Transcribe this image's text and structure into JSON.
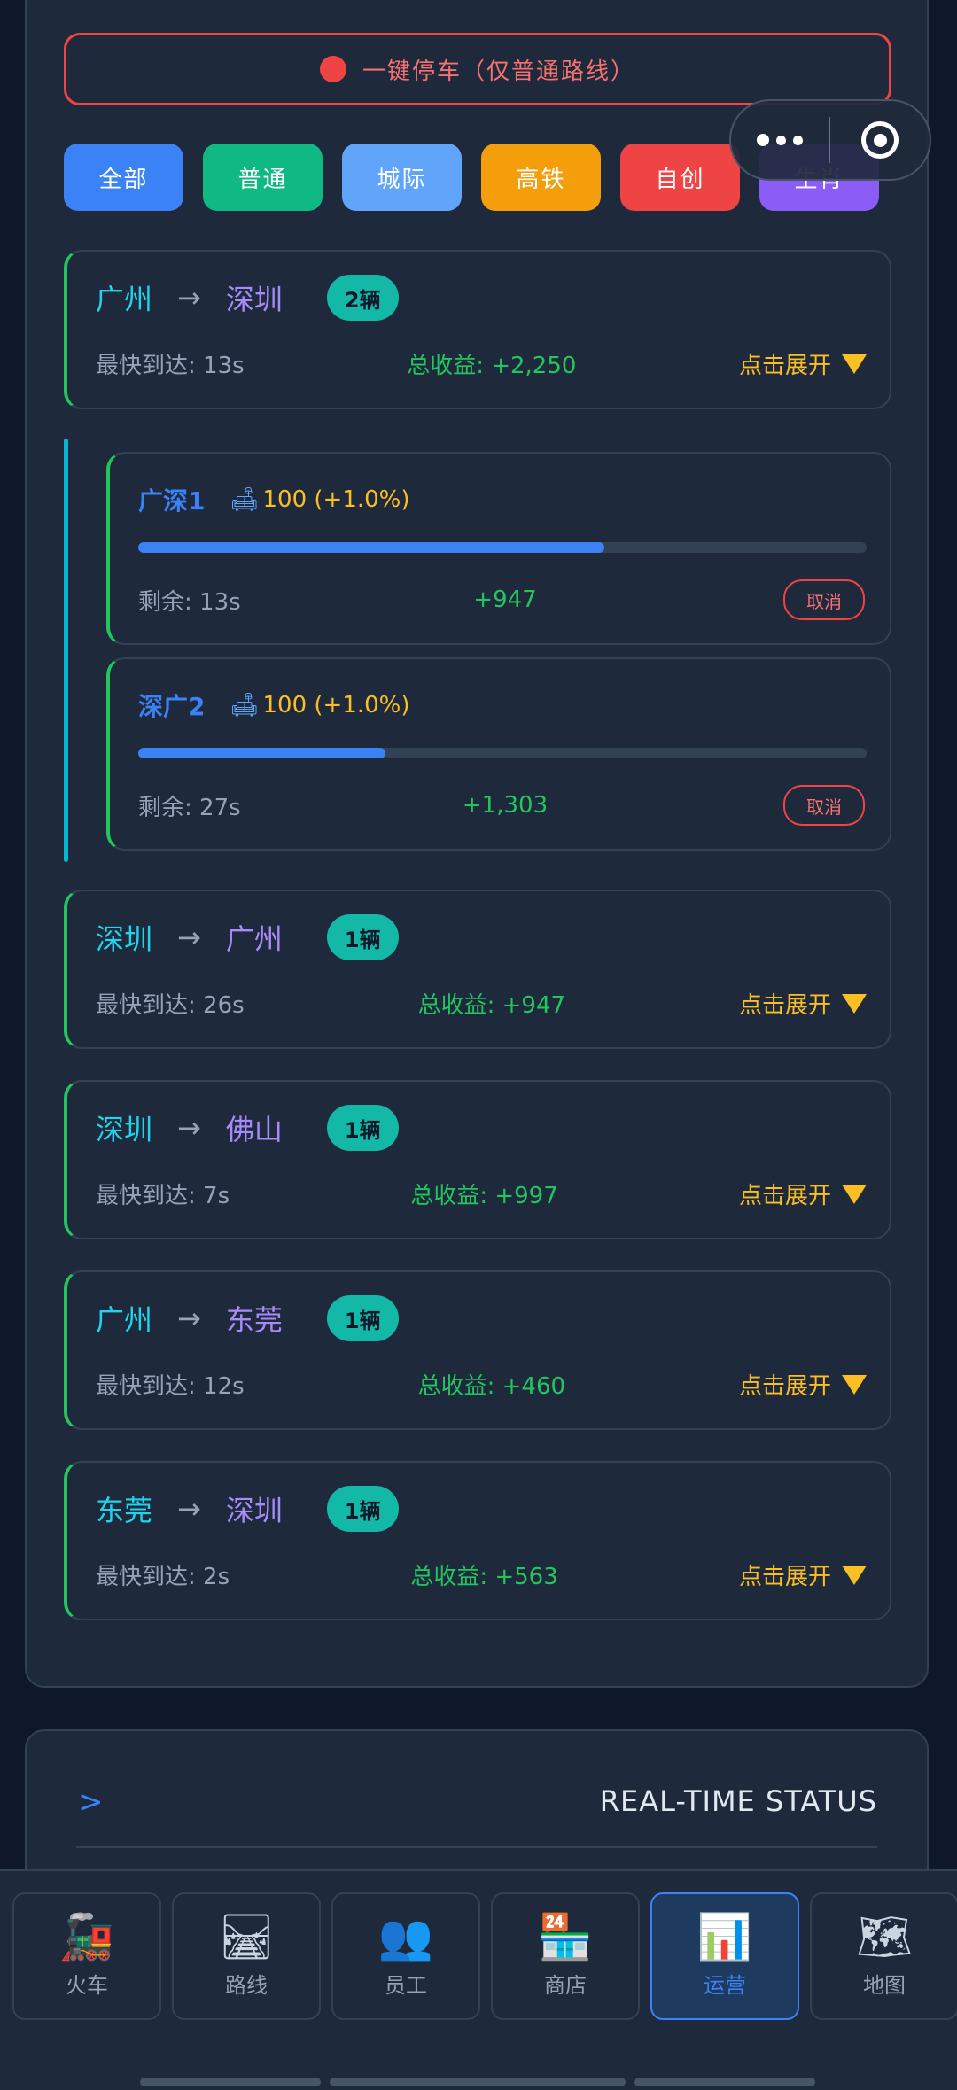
{
  "stop_button": {
    "label": "一键停车（仅普通路线）"
  },
  "filters": [
    {
      "label": "全部",
      "color": "#3b82f6"
    },
    {
      "label": "普通",
      "color": "#10b981"
    },
    {
      "label": "城际",
      "color": "#60a5fa"
    },
    {
      "label": "高铁",
      "color": "#f59e0b"
    },
    {
      "label": "自创",
      "color": "#ef4444"
    },
    {
      "label": "生肖",
      "color": "#8b5cf6"
    }
  ],
  "routes": [
    {
      "from": "广州",
      "arrow": "→",
      "to": "深圳",
      "count": "2辆",
      "fastest": "最快到达: 13s",
      "income": "总收益: +2,250",
      "expand": "点击展开"
    },
    {
      "from": "深圳",
      "arrow": "→",
      "to": "广州",
      "count": "1辆",
      "fastest": "最快到达: 26s",
      "income": "总收益: +947",
      "expand": "点击展开"
    },
    {
      "from": "深圳",
      "arrow": "→",
      "to": "佛山",
      "count": "1辆",
      "fastest": "最快到达: 7s",
      "income": "总收益: +997",
      "expand": "点击展开"
    },
    {
      "from": "广州",
      "arrow": "→",
      "to": "东莞",
      "count": "1辆",
      "fastest": "最快到达: 12s",
      "income": "总收益: +460",
      "expand": "点击展开"
    },
    {
      "from": "东莞",
      "arrow": "→",
      "to": "深圳",
      "count": "1辆",
      "fastest": "最快到达: 2s",
      "income": "总收益: +563",
      "expand": "点击展开"
    }
  ],
  "trains": [
    {
      "name": "广深1",
      "seat_icon": "🛋",
      "seats": "100 (+1.0%)",
      "progress": 0.64,
      "remaining": "剩余: 13s",
      "earn": "+947",
      "cancel": "取消"
    },
    {
      "name": "深广2",
      "seat_icon": "🛋",
      "seats": "100 (+1.0%)",
      "progress": 0.34,
      "remaining": "剩余: 27s",
      "earn": "+1,303",
      "cancel": "取消"
    }
  ],
  "status": {
    "chevron": ">",
    "title": "REAL-TIME STATUS"
  },
  "nav": [
    {
      "icon": "🚂",
      "label": "火车",
      "active": false
    },
    {
      "icon": "🛤",
      "label": "路线",
      "active": false
    },
    {
      "icon": "👥",
      "label": "员工",
      "active": false
    },
    {
      "icon": "🏪",
      "label": "商店",
      "active": false
    },
    {
      "icon": "📊",
      "label": "运营",
      "active": true
    },
    {
      "icon": "🗺",
      "label": "地图",
      "active": false
    }
  ]
}
